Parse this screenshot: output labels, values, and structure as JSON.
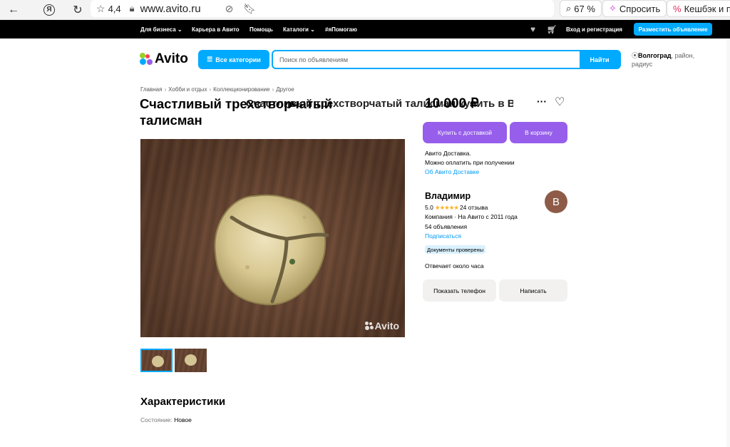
{
  "browser": {
    "back_icon": "arrow-left-icon",
    "yandex_icon": "Я",
    "refresh_icon": "refresh-icon",
    "rating": "4,4",
    "url": "www.avito.ru",
    "tab_title": "Счастливый трехстворчатый талисман купить в Вол...",
    "zoom": "67 %",
    "ask_label": "Спросить",
    "cashback_label": "Кешбэк и пр"
  },
  "topbar": {
    "business": "Для бизнеса ⌄",
    "career": "Карьера в Авито",
    "help": "Помощь",
    "catalogs": "Каталоги ⌄",
    "ya_help": "#яПомогаю",
    "login": "Вход и регистрация",
    "post_ad": "Разместить объявление"
  },
  "header": {
    "logo": "Avito",
    "categories_btn": "Все категории",
    "search_placeholder": "Поиск по объявлениям",
    "search_btn": "Найти",
    "location_city": "Волгоград",
    "location_rest": ", район, радиус"
  },
  "breadcrumbs": [
    "Главная",
    "Хобби и отдых",
    "Коллекционирование",
    "Другое"
  ],
  "listing": {
    "title": "Счастливый трехстворчатый талисман",
    "watermark": "Avito",
    "price": "10 000 ₽",
    "buy_delivery": "Купить с доставкой",
    "to_cart": "В корзину",
    "delivery_line1": "Авито Доставка.",
    "delivery_line2": "Можно оплатить при получении",
    "delivery_link": "Об Авито Доставке"
  },
  "seller": {
    "name": "Владимир",
    "rating": "5.0",
    "stars": "★★★★★",
    "reviews": "24 отзыва",
    "company": "Компания · На Авито с 2011 года",
    "ads_count": "54 объявления",
    "subscribe": "Подписаться",
    "docs_badge": "Документы проверены",
    "avatar_letter": "В",
    "reply_time": "Отвечает около часа",
    "show_phone": "Показать телефон",
    "write": "Написать"
  },
  "characteristics": {
    "heading": "Характеристики",
    "rows": [
      {
        "label": "Состояние: ",
        "value": "Новое"
      }
    ]
  },
  "colors": {
    "accent": "#00aaff",
    "purple": "#965eeb",
    "link": "#0099f7"
  }
}
